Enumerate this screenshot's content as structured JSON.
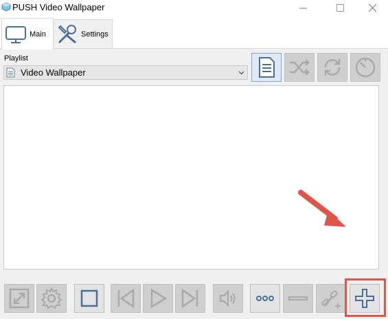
{
  "window": {
    "title": "PUSH Video Wallpaper",
    "controls": [
      "minimize-icon",
      "maximize-icon",
      "close-icon"
    ]
  },
  "tabs": [
    {
      "label": "Main",
      "icon": "monitor-icon",
      "selected": true
    },
    {
      "label": "Settings",
      "icon": "tools-icon",
      "selected": false
    }
  ],
  "playlist": {
    "label": "Playlist",
    "selected": "Video Wallpaper",
    "icon": "document-icon"
  },
  "top_toolbar": [
    "playlist-edit-icon",
    "shuffle-icon",
    "repeat-icon",
    "timer-icon"
  ],
  "bottom_toolbar": [
    "fullscreen-icon",
    "gear-icon",
    "stop-icon",
    "previous-icon",
    "play-icon",
    "next-icon",
    "volume-icon",
    "more-icon",
    "remove-icon",
    "add-url-icon",
    "add-icon"
  ],
  "colors": {
    "panel_bg": "#f0f0f0",
    "icon_gray": "#b0b0b0",
    "icon_blue": "#4a6f96",
    "highlight": "#e0554a"
  }
}
